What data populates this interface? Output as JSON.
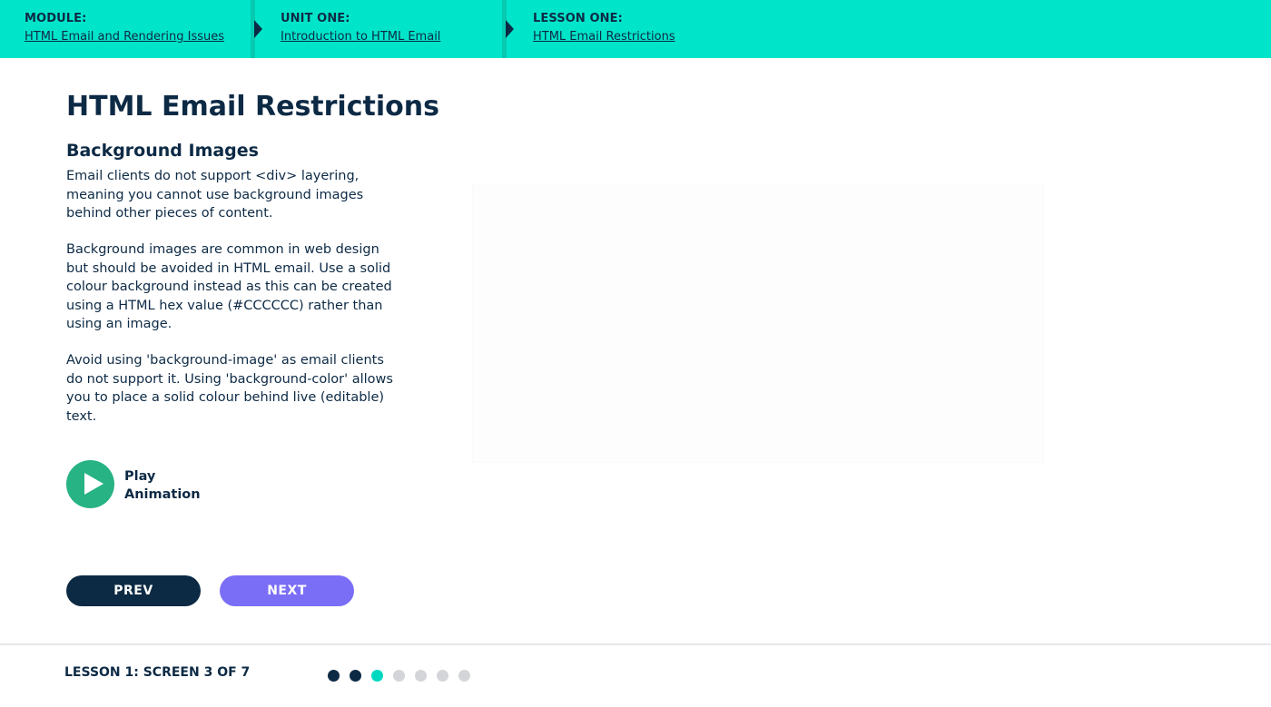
{
  "breadcrumb": [
    {
      "title": "MODULE:",
      "link": "HTML Email and Rendering Issues"
    },
    {
      "title": "UNIT ONE:",
      "link": "Introduction to HTML Email"
    },
    {
      "title": "LESSON ONE:",
      "link": "HTML Email Restrictions"
    }
  ],
  "main": {
    "title": "HTML Email Restrictions",
    "section_title": "Background Images",
    "paragraphs": [
      "Email clients do not support <div> layering, meaning you cannot use background images behind other pieces of content.",
      "Background images are common in web design but should be avoided in HTML email. Use a solid colour background instead as this can be created using a HTML hex value (#CCCCCC) rather than using an image.",
      "Avoid using 'background-image' as email clients do not support it. Using 'background-color' allows you to place a solid colour behind live (editable) text."
    ],
    "play_label": "Play Animation"
  },
  "nav": {
    "prev_label": "PREV",
    "next_label": "NEXT"
  },
  "footer": {
    "progress_text": "LESSON 1: SCREEN 3 OF 7",
    "dots": [
      "completed",
      "completed",
      "current",
      "upcoming",
      "upcoming",
      "upcoming",
      "upcoming"
    ]
  },
  "colors": {
    "header_bg": "#00e5c9",
    "navy": "#0d2a45",
    "play_green": "#27b383",
    "next_purple": "#7b6ef6",
    "dot_completed": "#0d2a45",
    "dot_current": "#00d9c0",
    "dot_upcoming": "#d3d5d8"
  },
  "icons": {
    "breadcrumb_separator": "chevron-right-icon",
    "play": "play-icon"
  }
}
